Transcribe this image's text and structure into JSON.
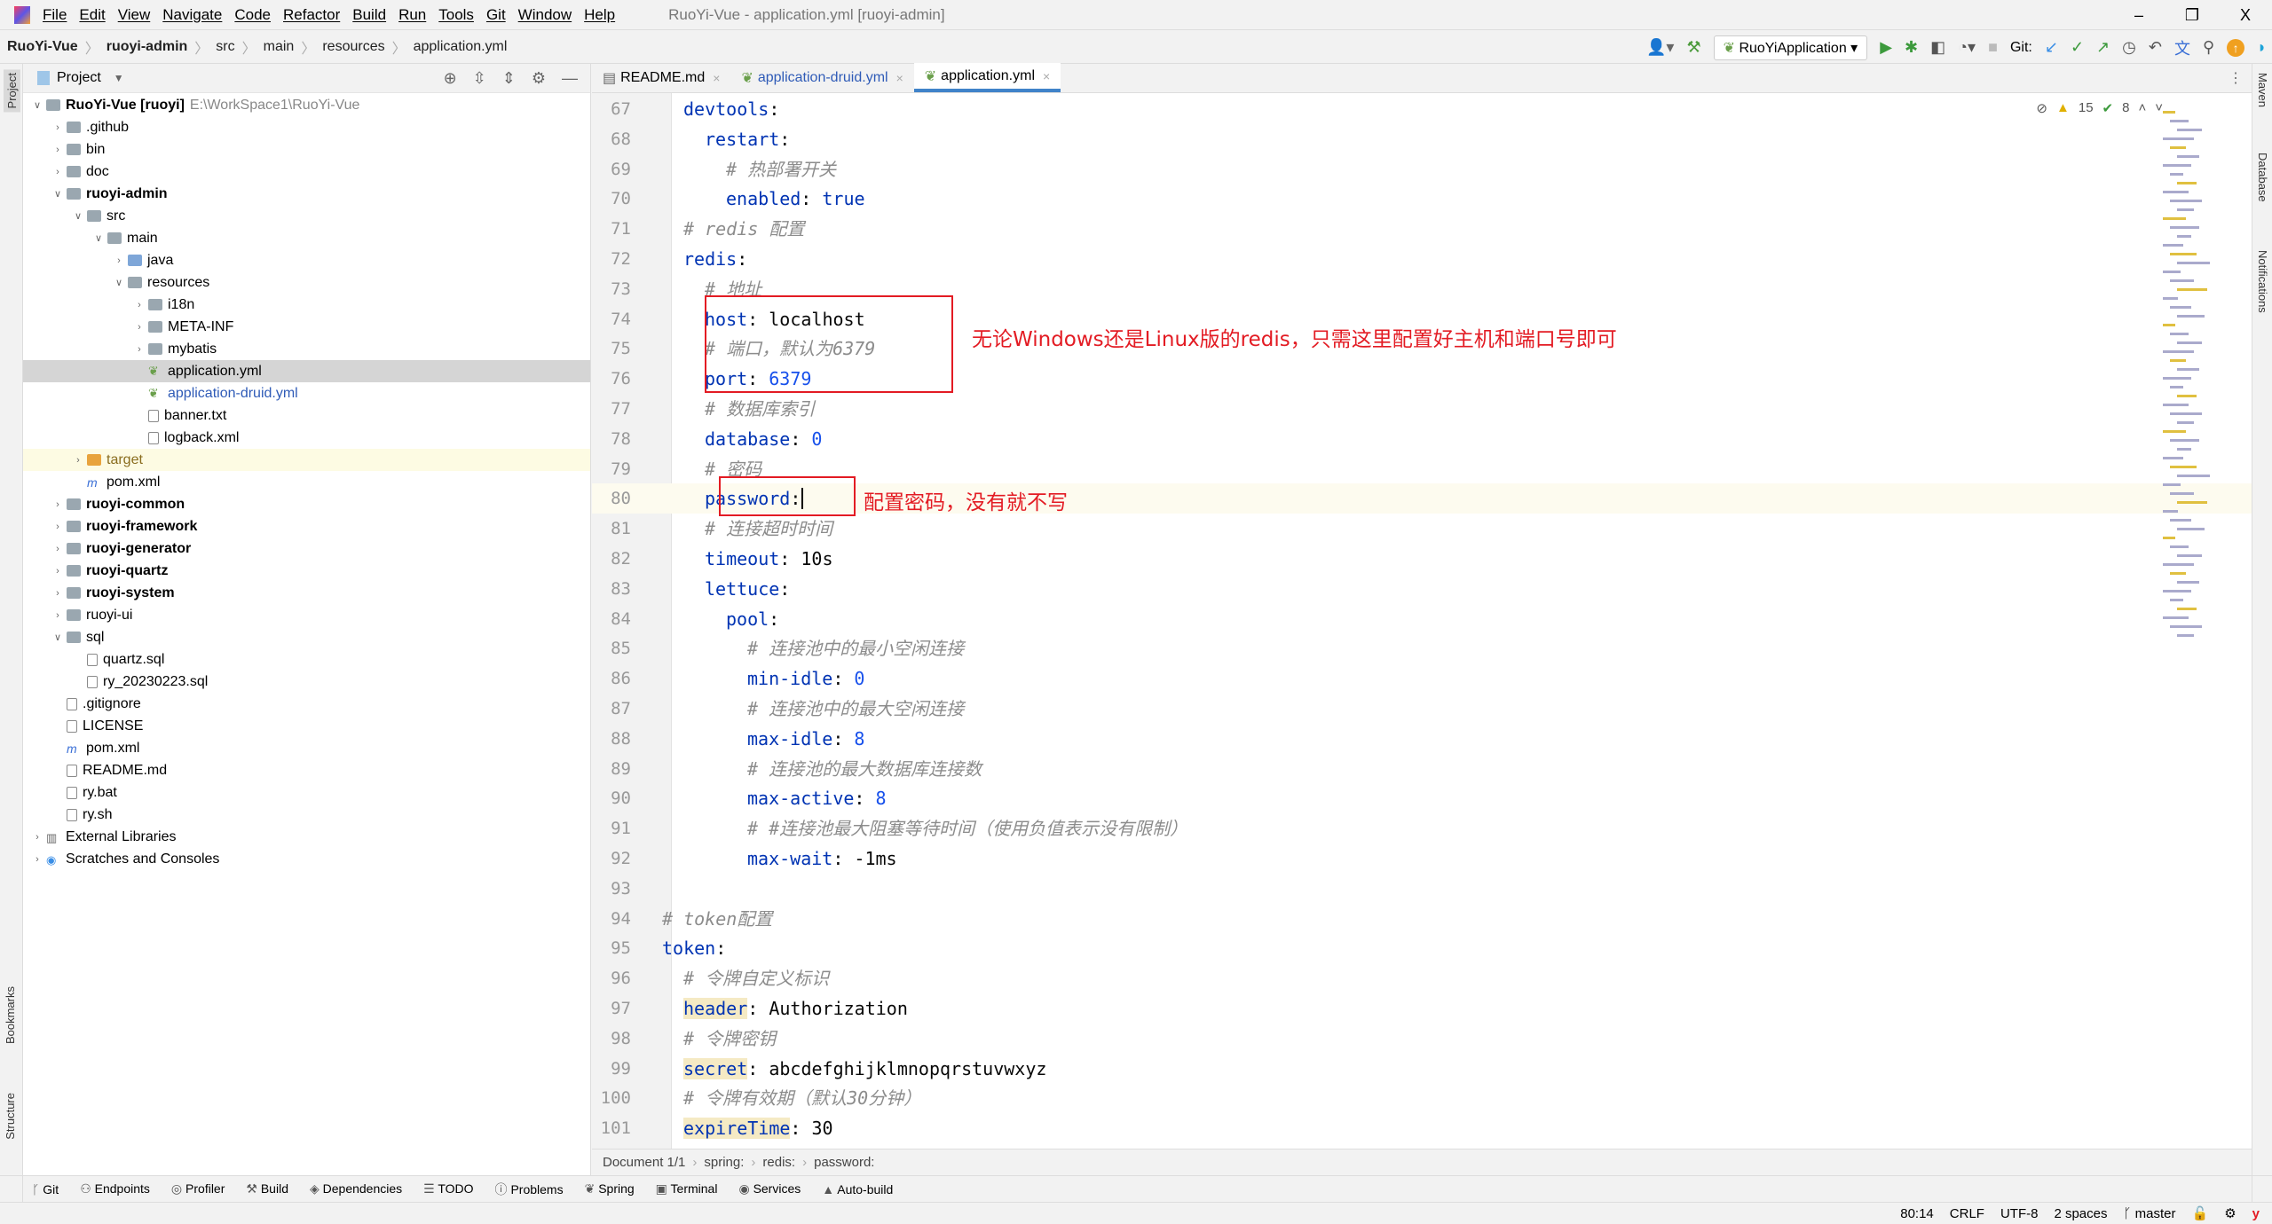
{
  "menu": {
    "items": [
      "File",
      "Edit",
      "View",
      "Navigate",
      "Code",
      "Refactor",
      "Build",
      "Run",
      "Tools",
      "Git",
      "Window",
      "Help"
    ],
    "window_title": "RuoYi-Vue - application.yml [ruoyi-admin]"
  },
  "window_controls": {
    "minimize": "–",
    "restore": "❐",
    "close": "X"
  },
  "breadcrumb": [
    "RuoYi-Vue",
    "ruoyi-admin",
    "src",
    "main",
    "resources",
    "application.yml"
  ],
  "toolbar": {
    "run_config": "RuoYiApplication",
    "git_label": "Git:"
  },
  "left_stripe": {
    "project": "Project",
    "bookmarks": "Bookmarks",
    "structure": "Structure"
  },
  "right_stripe": {
    "maven": "Maven",
    "database": "Database",
    "notifications": "Notifications"
  },
  "project_panel": {
    "title": "Project",
    "tree": [
      {
        "label": "RuoYi-Vue [ruoyi]",
        "path": "E:\\WorkSpace1\\RuoYi-Vue",
        "depth": 0,
        "expanded": true,
        "icon": "module",
        "bold": true
      },
      {
        "label": ".github",
        "depth": 1,
        "expanded": false,
        "icon": "folder"
      },
      {
        "label": "bin",
        "depth": 1,
        "expanded": false,
        "icon": "folder"
      },
      {
        "label": "doc",
        "depth": 1,
        "expanded": false,
        "icon": "folder"
      },
      {
        "label": "ruoyi-admin",
        "depth": 1,
        "expanded": true,
        "icon": "folder",
        "bold": true
      },
      {
        "label": "src",
        "depth": 2,
        "expanded": true,
        "icon": "folder"
      },
      {
        "label": "main",
        "depth": 3,
        "expanded": true,
        "icon": "folder"
      },
      {
        "label": "java",
        "depth": 4,
        "expanded": false,
        "icon": "src"
      },
      {
        "label": "resources",
        "depth": 4,
        "expanded": true,
        "icon": "folder"
      },
      {
        "label": "i18n",
        "depth": 5,
        "expanded": false,
        "icon": "folder"
      },
      {
        "label": "META-INF",
        "depth": 5,
        "expanded": false,
        "icon": "folder"
      },
      {
        "label": "mybatis",
        "depth": 5,
        "expanded": false,
        "icon": "folder"
      },
      {
        "label": "application.yml",
        "depth": 5,
        "icon": "yml",
        "selected": true
      },
      {
        "label": "application-druid.yml",
        "depth": 5,
        "icon": "yml",
        "color": "#2f5bb7"
      },
      {
        "label": "banner.txt",
        "depth": 5,
        "icon": "file"
      },
      {
        "label": "logback.xml",
        "depth": 5,
        "icon": "file"
      },
      {
        "label": "target",
        "depth": 2,
        "expanded": false,
        "icon": "target",
        "highlight": true,
        "color": "#8a6d1f"
      },
      {
        "label": "pom.xml",
        "depth": 2,
        "icon": "maven"
      },
      {
        "label": "ruoyi-common",
        "depth": 1,
        "expanded": false,
        "icon": "folder",
        "bold": true
      },
      {
        "label": "ruoyi-framework",
        "depth": 1,
        "expanded": false,
        "icon": "folder",
        "bold": true
      },
      {
        "label": "ruoyi-generator",
        "depth": 1,
        "expanded": false,
        "icon": "folder",
        "bold": true
      },
      {
        "label": "ruoyi-quartz",
        "depth": 1,
        "expanded": false,
        "icon": "folder",
        "bold": true
      },
      {
        "label": "ruoyi-system",
        "depth": 1,
        "expanded": false,
        "icon": "folder",
        "bold": true
      },
      {
        "label": "ruoyi-ui",
        "depth": 1,
        "expanded": false,
        "icon": "folder"
      },
      {
        "label": "sql",
        "depth": 1,
        "expanded": true,
        "icon": "folder"
      },
      {
        "label": "quartz.sql",
        "depth": 2,
        "icon": "sql"
      },
      {
        "label": "ry_20230223.sql",
        "depth": 2,
        "icon": "sql"
      },
      {
        "label": ".gitignore",
        "depth": 1,
        "icon": "file"
      },
      {
        "label": "LICENSE",
        "depth": 1,
        "icon": "file"
      },
      {
        "label": "pom.xml",
        "depth": 1,
        "icon": "maven"
      },
      {
        "label": "README.md",
        "depth": 1,
        "icon": "md"
      },
      {
        "label": "ry.bat",
        "depth": 1,
        "icon": "file"
      },
      {
        "label": "ry.sh",
        "depth": 1,
        "icon": "file"
      },
      {
        "label": "External Libraries",
        "depth": 0,
        "expanded": false,
        "icon": "lib"
      },
      {
        "label": "Scratches and Consoles",
        "depth": 0,
        "expanded": false,
        "icon": "scratch"
      }
    ]
  },
  "tabs": [
    {
      "label": "README.md",
      "active": false
    },
    {
      "label": "application-druid.yml",
      "active": false,
      "color": "#2f5bb7"
    },
    {
      "label": "application.yml",
      "active": true
    }
  ],
  "inspections": {
    "warnings": "15",
    "ok": "8"
  },
  "editor": {
    "lines": [
      {
        "n": "67",
        "indent": 1,
        "parts": [
          [
            "k",
            "devtools"
          ],
          [
            "v",
            ":"
          ]
        ]
      },
      {
        "n": "68",
        "indent": 2,
        "parts": [
          [
            "k",
            "restart"
          ],
          [
            "v",
            ":"
          ]
        ]
      },
      {
        "n": "69",
        "indent": 3,
        "parts": [
          [
            "c",
            "# 热部署开关"
          ]
        ]
      },
      {
        "n": "70",
        "indent": 3,
        "parts": [
          [
            "k",
            "enabled"
          ],
          [
            "v",
            ": "
          ],
          [
            "k",
            "true"
          ]
        ]
      },
      {
        "n": "71",
        "indent": 1,
        "parts": [
          [
            "c",
            "# redis 配置"
          ]
        ]
      },
      {
        "n": "72",
        "indent": 1,
        "parts": [
          [
            "k",
            "redis"
          ],
          [
            "v",
            ":"
          ]
        ]
      },
      {
        "n": "73",
        "indent": 2,
        "parts": [
          [
            "c",
            "# 地址"
          ]
        ]
      },
      {
        "n": "74",
        "indent": 2,
        "parts": [
          [
            "k",
            "host"
          ],
          [
            "v",
            ": localhost"
          ]
        ]
      },
      {
        "n": "75",
        "indent": 2,
        "parts": [
          [
            "c",
            "# 端口，默认为6379"
          ]
        ]
      },
      {
        "n": "76",
        "indent": 2,
        "parts": [
          [
            "k",
            "port"
          ],
          [
            "v",
            ": "
          ],
          [
            "n",
            "6379"
          ]
        ]
      },
      {
        "n": "77",
        "indent": 2,
        "parts": [
          [
            "c",
            "# 数据库索引"
          ]
        ]
      },
      {
        "n": "78",
        "indent": 2,
        "parts": [
          [
            "k",
            "database"
          ],
          [
            "v",
            ": "
          ],
          [
            "n",
            "0"
          ]
        ]
      },
      {
        "n": "79",
        "indent": 2,
        "parts": [
          [
            "c",
            "# 密码"
          ]
        ]
      },
      {
        "n": "80",
        "indent": 2,
        "current": true,
        "parts": [
          [
            "k",
            "password"
          ],
          [
            "v",
            ":"
          ]
        ]
      },
      {
        "n": "81",
        "indent": 2,
        "parts": [
          [
            "c",
            "# 连接超时时间"
          ]
        ]
      },
      {
        "n": "82",
        "indent": 2,
        "parts": [
          [
            "k",
            "timeout"
          ],
          [
            "v",
            ": 10s"
          ]
        ]
      },
      {
        "n": "83",
        "indent": 2,
        "parts": [
          [
            "k",
            "lettuce"
          ],
          [
            "v",
            ":"
          ]
        ]
      },
      {
        "n": "84",
        "indent": 3,
        "parts": [
          [
            "k",
            "pool"
          ],
          [
            "v",
            ":"
          ]
        ]
      },
      {
        "n": "85",
        "indent": 4,
        "parts": [
          [
            "c",
            "# 连接池中的最小空闲连接"
          ]
        ]
      },
      {
        "n": "86",
        "indent": 4,
        "parts": [
          [
            "k",
            "min-idle"
          ],
          [
            "v",
            ": "
          ],
          [
            "n",
            "0"
          ]
        ]
      },
      {
        "n": "87",
        "indent": 4,
        "parts": [
          [
            "c",
            "# 连接池中的最大空闲连接"
          ]
        ]
      },
      {
        "n": "88",
        "indent": 4,
        "parts": [
          [
            "k",
            "max-idle"
          ],
          [
            "v",
            ": "
          ],
          [
            "n",
            "8"
          ]
        ]
      },
      {
        "n": "89",
        "indent": 4,
        "parts": [
          [
            "c",
            "# 连接池的最大数据库连接数"
          ]
        ]
      },
      {
        "n": "90",
        "indent": 4,
        "parts": [
          [
            "k",
            "max-active"
          ],
          [
            "v",
            ": "
          ],
          [
            "n",
            "8"
          ]
        ]
      },
      {
        "n": "91",
        "indent": 4,
        "parts": [
          [
            "c",
            "# #连接池最大阻塞等待时间（使用负值表示没有限制）"
          ]
        ]
      },
      {
        "n": "92",
        "indent": 4,
        "parts": [
          [
            "k",
            "max-wait"
          ],
          [
            "v",
            ": -1ms"
          ]
        ]
      },
      {
        "n": "93",
        "indent": 0,
        "parts": []
      },
      {
        "n": "94",
        "indent": 0,
        "parts": [
          [
            "c",
            "# token配置"
          ]
        ]
      },
      {
        "n": "95",
        "indent": 0,
        "parts": [
          [
            "k",
            "token"
          ],
          [
            "v",
            ":"
          ]
        ]
      },
      {
        "n": "96",
        "indent": 1,
        "parts": [
          [
            "c",
            "# 令牌自定义标识"
          ]
        ]
      },
      {
        "n": "97",
        "indent": 1,
        "parts": [
          [
            "kh",
            "header"
          ],
          [
            "v",
            ": Authorization"
          ]
        ]
      },
      {
        "n": "98",
        "indent": 1,
        "parts": [
          [
            "c",
            "# 令牌密钥"
          ]
        ]
      },
      {
        "n": "99",
        "indent": 1,
        "parts": [
          [
            "kh",
            "secret"
          ],
          [
            "v",
            ": abcdefghijklmnopqrstuvwxyz"
          ]
        ]
      },
      {
        "n": "100",
        "indent": 1,
        "parts": [
          [
            "c",
            "# 令牌有效期（默认30分钟）"
          ]
        ]
      },
      {
        "n": "101",
        "indent": 1,
        "parts": [
          [
            "kh",
            "expireTime"
          ],
          [
            "v",
            ": 30"
          ]
        ]
      }
    ]
  },
  "annotations": {
    "host_port": "无论Windows还是Linux版的redis，只需这里配置好主机和端口号即可",
    "password": "配置密码，没有就不写",
    "color": "#e31b23"
  },
  "editor_breadcrumb": [
    "Document 1/1",
    "spring:",
    "redis:",
    "password:"
  ],
  "tool_windows": [
    "Git",
    "Endpoints",
    "Profiler",
    "Build",
    "Dependencies",
    "TODO",
    "Problems",
    "Spring",
    "Terminal",
    "Services",
    "Auto-build"
  ],
  "status": {
    "position": "80:14",
    "line_sep": "CRLF",
    "encoding": "UTF-8",
    "indent": "2 spaces",
    "branch": "master"
  }
}
